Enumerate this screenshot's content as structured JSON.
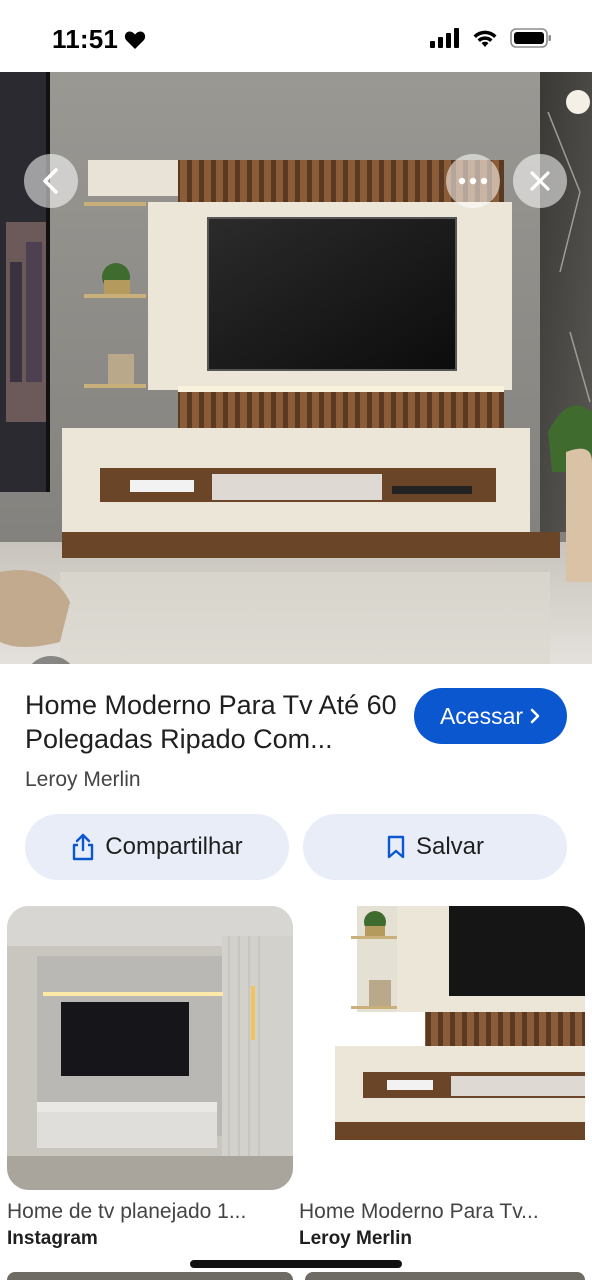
{
  "status_bar": {
    "time": "11:51"
  },
  "hero": {
    "image_alt": "Home moderno com painel ripado e TV"
  },
  "result": {
    "title": "Home Moderno Para Tv Até 60 Polegadas Ripado Com...",
    "source": "Leroy Merlin",
    "visit_label": "Acessar",
    "share_label": "Compartilhar",
    "save_label": "Salvar"
  },
  "related": [
    {
      "title": "Home de tv planejado 1...",
      "source": "Instagram"
    },
    {
      "title": "Home Moderno Para Tv...",
      "source": "Leroy Merlin"
    }
  ],
  "colors": {
    "accent": "#0b57d0",
    "chip_bg": "#e8edf8"
  },
  "icons": [
    "heart-icon",
    "signal-icon",
    "wifi-icon",
    "battery-icon",
    "back-arrow-icon",
    "more-dots-icon",
    "close-icon",
    "lens-icon",
    "share-icon",
    "bookmark-icon",
    "chevron-right-icon"
  ]
}
